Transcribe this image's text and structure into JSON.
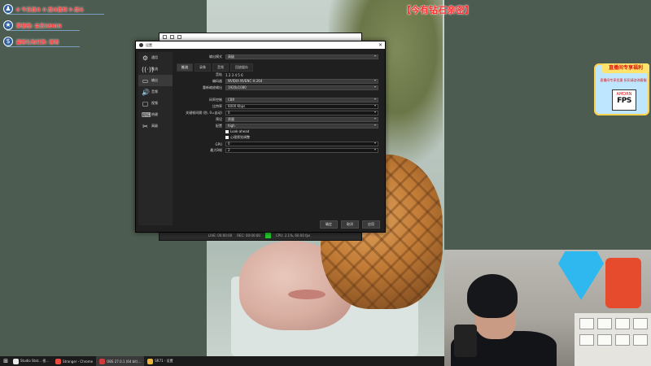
{
  "overlay": {
    "rows": [
      {
        "icon": "person-icon",
        "glyph": "♟",
        "text": "0 今日战斗 0 战斗胜利 0 战斗"
      },
      {
        "icon": "star-icon",
        "glyph": "★",
        "text": "荣誉榜: 会员REIGN"
      },
      {
        "icon": "dollar-icon",
        "glyph": "$",
        "text": "最新礼物打赏: 狮哥"
      }
    ]
  },
  "banner": "【今有钻石亲密】",
  "promo": {
    "title": "直播间专享福利",
    "subtitle": "直播间专享优惠 折扣请咨询客服",
    "logo_top": "AMORN",
    "logo_main": "FPS"
  },
  "obs_back": {
    "status": [
      "LIVE: 00:00:00",
      "REC: 00:00:00",
      "CPU: 2.1%, 60.00 fps"
    ],
    "led_color": "#21c52b"
  },
  "dialog": {
    "title": "设置",
    "close": "✕",
    "nav": [
      {
        "icon": "gear-icon",
        "glyph": "⚙",
        "label": "通用"
      },
      {
        "icon": "stream-icon",
        "glyph": "((·))",
        "label": "推流"
      },
      {
        "icon": "output-icon",
        "glyph": "▭",
        "label": "输出"
      },
      {
        "icon": "audio-icon",
        "glyph": "🔊",
        "label": "音频"
      },
      {
        "icon": "video-icon",
        "glyph": "▢",
        "label": "视频"
      },
      {
        "icon": "hotkeys-icon",
        "glyph": "⌨",
        "label": "热键"
      },
      {
        "icon": "advanced-icon",
        "glyph": "✂",
        "label": "高级"
      }
    ],
    "active_nav": 2,
    "output_mode": {
      "label": "输出模式",
      "value": "高级"
    },
    "subtabs": [
      "推流",
      "录像",
      "音频",
      "回放缓存"
    ],
    "active_subtab": 0,
    "fields": {
      "audio_track": {
        "label": "音轨",
        "value": "1 2 3 4 5 6"
      },
      "encoder": {
        "label": "编码器",
        "value": "NVIDIA NVENC H.264"
      },
      "rescale": {
        "label": "重新缩放输出",
        "value": "1920x1080"
      },
      "rate_control": {
        "label": "码率控制",
        "value": "CBR"
      },
      "bitrate": {
        "label": "比特率",
        "value": "6000 Kbps"
      },
      "keyframe": {
        "label": "关键帧间隔 (秒, 0=自动)",
        "value": "0"
      },
      "preset": {
        "label": "预设",
        "value": "质量"
      },
      "profile": {
        "label": "配置",
        "value": "high"
      },
      "lookahead": {
        "label": "Look-ahead",
        "checked": true
      },
      "psycho": {
        "label": "心理视觉调整",
        "checked": true
      },
      "gpu": {
        "label": "GPU",
        "value": "0"
      },
      "bframes": {
        "label": "最大B帧",
        "value": "2"
      }
    },
    "buttons": {
      "ok": "确定",
      "cancel": "取消",
      "apply": "应用"
    }
  },
  "taskbar": {
    "start_glyph": "⊞",
    "items": [
      {
        "icon": "obs-taskbar-icon",
        "color": "#e9e9e9",
        "label": "Studio Stat... 视..."
      },
      {
        "icon": "chrome-taskbar-icon",
        "color": "#e84a3f",
        "label": "Stranger - Chrome"
      },
      {
        "icon": "app-taskbar-icon",
        "color": "#d03a3a",
        "label": "OBS 27.0.1 (64 bit)..."
      },
      {
        "icon": "folder-taskbar-icon",
        "color": "#e8b43a",
        "label": "SR71 - 设置"
      }
    ],
    "active_index": 2
  }
}
